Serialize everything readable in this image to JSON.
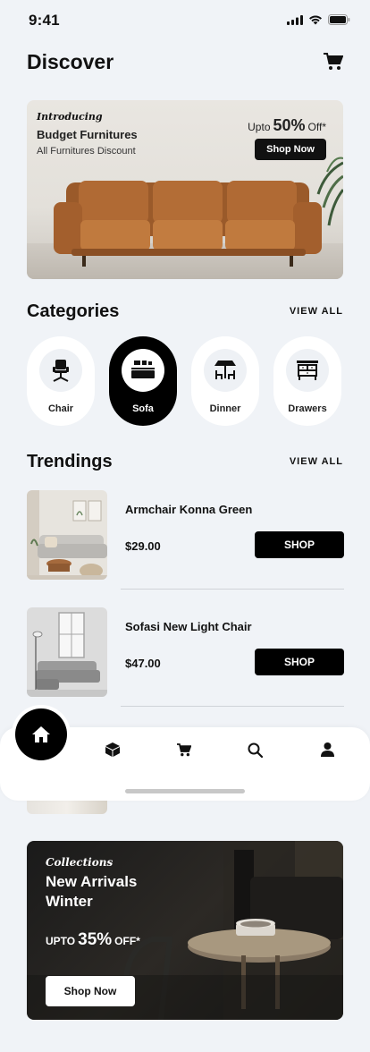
{
  "status_bar": {
    "time": "9:41"
  },
  "header": {
    "title": "Discover"
  },
  "hero": {
    "introducing": "Introducing",
    "title": "Budget Furnitures",
    "subtitle": "All Furnitures Discount",
    "upto_prefix": "Upto",
    "upto_value": "50%",
    "upto_suffix": "Off*",
    "button_label": "Shop Now"
  },
  "categories": {
    "title": "Categories",
    "view_all": "VIEW ALL",
    "items": [
      {
        "label": "Chair",
        "icon": "chair-icon",
        "active": false
      },
      {
        "label": "Sofa",
        "icon": "sofa-icon",
        "active": true
      },
      {
        "label": "Dinner",
        "icon": "dining-table-icon",
        "active": false
      },
      {
        "label": "Drawers",
        "icon": "drawers-icon",
        "active": false
      }
    ]
  },
  "trendings": {
    "title": "Trendings",
    "view_all": "VIEW ALL",
    "items": [
      {
        "name": "Armchair Konna Green",
        "price": "$29.00",
        "button": "SHOP"
      },
      {
        "name": "Sofasi New Light Chair",
        "price": "$47.00",
        "button": "SHOP"
      }
    ]
  },
  "bottom_nav": {
    "items": [
      "home-icon",
      "box-icon",
      "cart-icon",
      "search-icon",
      "profile-icon"
    ],
    "active": "home-icon"
  },
  "collection": {
    "script": "Collections",
    "title": "New Arrivals Winter",
    "upto_prefix": "UPTO",
    "upto_value": "35%",
    "upto_suffix": "OFF*",
    "button_label": "Shop Now"
  },
  "colors": {
    "accent": "#000000",
    "background": "#f0f3f7",
    "card": "#ffffff"
  }
}
